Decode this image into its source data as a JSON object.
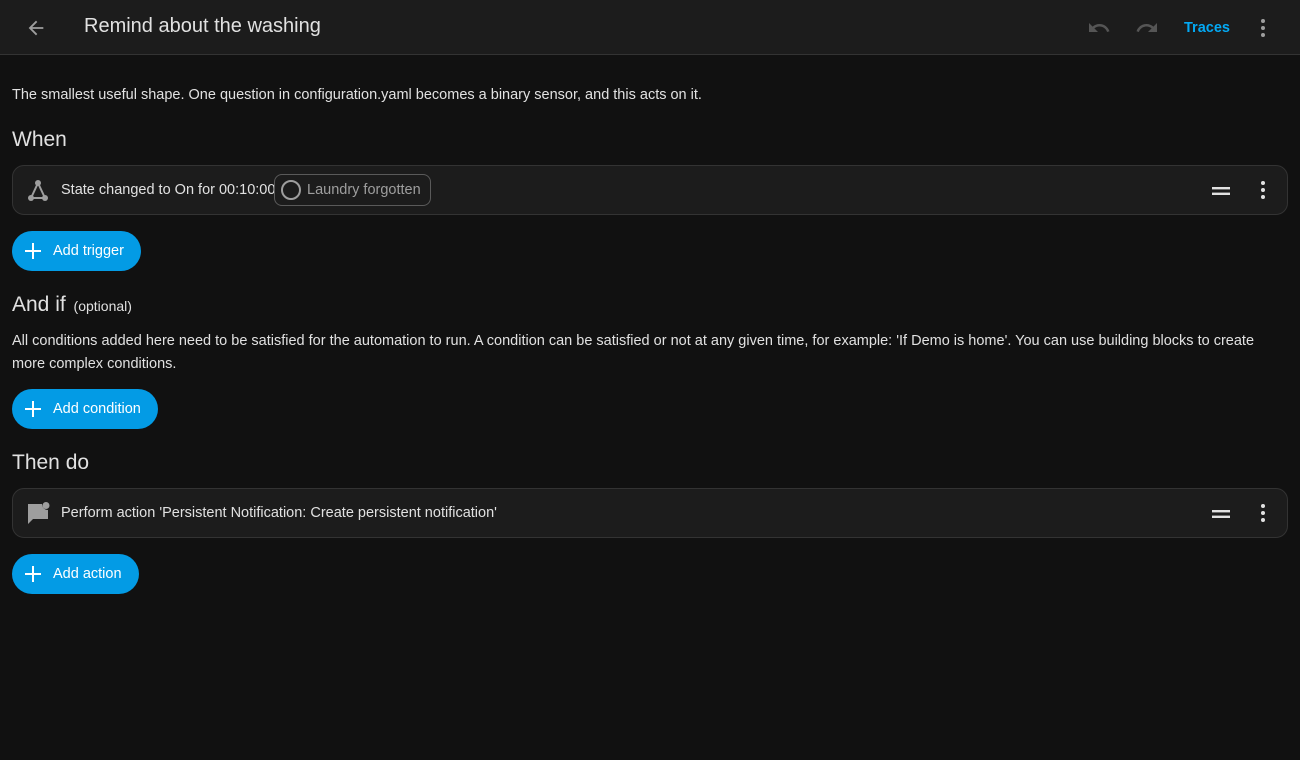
{
  "header": {
    "title": "Remind about the washing",
    "traces_label": "Traces",
    "icons": {
      "back": "arrow-left-icon",
      "undo": "undo-icon",
      "redo": "redo-icon",
      "menu": "dots-vertical-icon"
    }
  },
  "description": "The smallest useful shape. One question in configuration.yaml becomes a binary sensor, and this acts on it.",
  "when": {
    "title": "When",
    "triggers": [
      {
        "icon": "state-graph-icon",
        "text": "State changed to On for 00:10:00",
        "entity_chip": "Laundry forgotten"
      }
    ],
    "add_label": "Add trigger"
  },
  "and_if": {
    "title": "And if",
    "optional_label": "(optional)",
    "description": "All conditions added here need to be satisfied for the automation to run. A condition can be satisfied or not at any given time, for example: 'If Demo is home'. You can use building blocks to create more complex conditions.",
    "add_label": "Add condition"
  },
  "then_do": {
    "title": "Then do",
    "actions": [
      {
        "icon": "message-badge-icon",
        "text": "Perform action 'Persistent Notification: Create persistent notification'"
      }
    ],
    "add_label": "Add action"
  },
  "colors": {
    "accent": "#03a9f4",
    "button": "#039be5",
    "background": "#111111",
    "card": "#1c1c1c"
  }
}
